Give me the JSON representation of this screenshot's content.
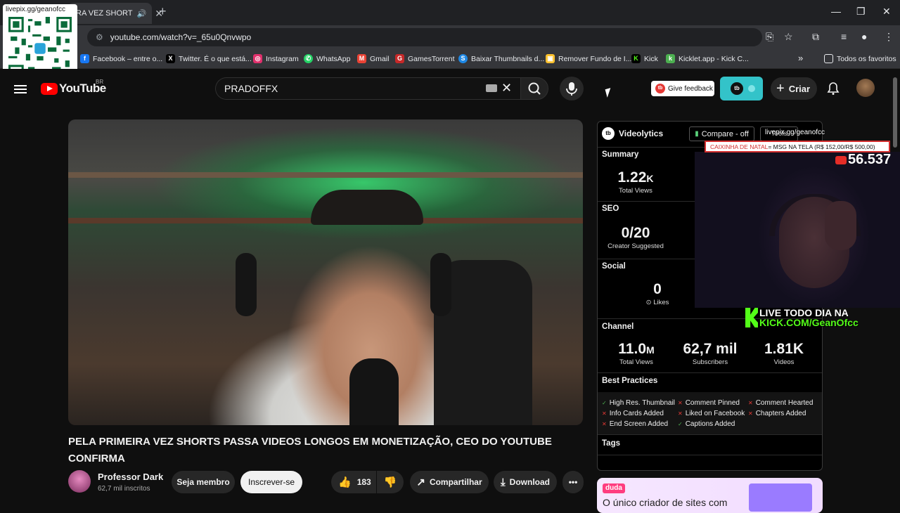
{
  "browser": {
    "tab_title": "RA VEZ SHORT",
    "url": "youtube.com/watch?v=_65u0Qnvwpo",
    "bookmarks": [
      {
        "label": "Facebook – entre o...",
        "icon": "facebook-icon",
        "color": "#1877f2"
      },
      {
        "label": "Twitter. É o que está...",
        "icon": "x-twitter-icon",
        "color": "#000000"
      },
      {
        "label": "Instagram",
        "icon": "instagram-icon",
        "color": "#e1306c"
      },
      {
        "label": "WhatsApp",
        "icon": "whatsapp-icon",
        "color": "#25d366"
      },
      {
        "label": "Gmail",
        "icon": "gmail-icon",
        "color": "#ea4335"
      },
      {
        "label": "GamesTorrent",
        "icon": "gamestorrent-icon",
        "color": "#c62828"
      },
      {
        "label": "Baixar Thumbnails d...",
        "icon": "thumbnails-icon",
        "color": "#1e88e5"
      },
      {
        "label": "Remover Fundo de I...",
        "icon": "remove-bg-icon",
        "color": "#fbc02d"
      },
      {
        "label": "Kick",
        "icon": "kick-icon",
        "color": "#53fc18"
      },
      {
        "label": "Kicklet.app - Kick C...",
        "icon": "kicklet-icon",
        "color": "#4caf50"
      }
    ],
    "bookmarks_overflow": "»",
    "all_bookmarks": "Todos os favoritos"
  },
  "overlay": {
    "qr_label": "livepix.gg/geanofcc",
    "livepix_small": "livepix.gg/geanofcc",
    "banner_red": "CAIXINHA DE NATAL",
    "banner_text": "= MSG NA TELA (R$ 152,00/R$ 500,00)",
    "counter": "56.537",
    "live_line1": "LIVE TODO DIA NA",
    "live_line2": "KICK.COM/GeanOfcc"
  },
  "youtube": {
    "logo_text": "YouTube",
    "region": "BR",
    "search_query": "PRADOFFX",
    "give_feedback": "Give feedback",
    "create": "Criar",
    "video_title": "PELA PRIMEIRA VEZ SHORTS PASSA VIDEOS LONGOS EM MONETIZAÇÃO, CEO DO YOUTUBE CONFIRMA",
    "channel_name": "Professor Dark",
    "channel_subs": "62,7 mil inscritos",
    "member_button": "Seja membro",
    "subscribe_button": "Inscrever-se",
    "likes": "183",
    "share": "Compartilhar",
    "download": "Download"
  },
  "videolytics": {
    "title": "Videolytics",
    "compare": "Compare - off",
    "tools": "Tools",
    "summary_label": "Summary",
    "total_views": {
      "value": "1.22",
      "suffix": "K",
      "label": "Total Views"
    },
    "seo_label": "SEO",
    "seo_score": {
      "value": "0/20",
      "label": "Creator Suggested"
    },
    "social_label": "Social",
    "likes": {
      "value": "0",
      "label": "Likes"
    },
    "channel_label": "Channel",
    "channel_views": {
      "value": "11.0",
      "suffix": "M",
      "label": "Total Views"
    },
    "channel_subs": {
      "value": "62,7 mil",
      "label": "Subscribers"
    },
    "channel_videos": {
      "value": "1.81K",
      "label": "Videos"
    },
    "best_practices_label": "Best Practices",
    "best_practices": [
      {
        "label": "High Res. Thumbnail",
        "status": "ok"
      },
      {
        "label": "Comment Pinned",
        "status": "fail"
      },
      {
        "label": "Comment Hearted",
        "status": "fail"
      },
      {
        "label": "Info Cards Added",
        "status": "fail"
      },
      {
        "label": "Liked on Facebook",
        "status": "fail"
      },
      {
        "label": "Chapters Added",
        "status": "fail"
      },
      {
        "label": "End Screen Added",
        "status": "fail"
      },
      {
        "label": "Captions Added",
        "status": "ok"
      }
    ],
    "tags_label": "Tags"
  },
  "ad": {
    "brand": "duda",
    "headline": "O único criador de sites com"
  }
}
